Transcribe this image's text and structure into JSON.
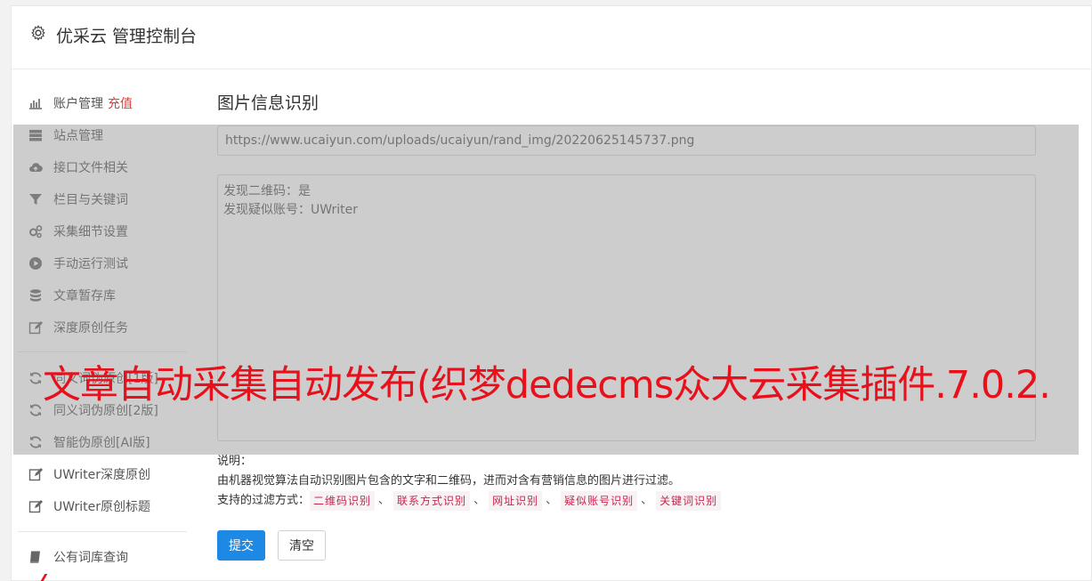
{
  "header": {
    "title": "优采云 管理控制台",
    "icon": "gear-icon"
  },
  "sidebar": {
    "items": [
      {
        "label": "账户管理",
        "extra": "充值",
        "icon": "bar-chart-icon"
      },
      {
        "label": "站点管理",
        "icon": "server-icon"
      },
      {
        "label": "接口文件相关",
        "icon": "cloud-upload-icon"
      },
      {
        "label": "栏目与关键词",
        "icon": "filter-icon"
      },
      {
        "label": "采集细节设置",
        "icon": "gears-icon"
      },
      {
        "label": "手动运行测试",
        "icon": "play-circle-icon"
      },
      {
        "label": "文章暂存库",
        "icon": "database-icon"
      },
      {
        "label": "深度原创任务",
        "icon": "edit-icon"
      },
      {
        "label": "同义词伪原创[1版]",
        "icon": "refresh-icon"
      },
      {
        "label": "同义词伪原创[2版]",
        "icon": "refresh-icon"
      },
      {
        "label": "智能伪原创[AI版]",
        "icon": "refresh-icon"
      },
      {
        "label": "UWriter深度原创",
        "icon": "edit-icon"
      },
      {
        "label": "UWriter原创标题",
        "icon": "edit-icon"
      },
      {
        "label": "公有词库查询",
        "icon": "book-icon"
      }
    ]
  },
  "main": {
    "title": "图片信息识别",
    "url_value": "https://www.ucaiyun.com/uploads/ucaiyun/rand_img/20220625145737.png",
    "result_lines": [
      "发现二维码：是",
      "发现疑似账号：UWriter"
    ],
    "notes": {
      "heading": "说明：",
      "description": "由机器视觉算法自动识别图片包含的文字和二维码，进而对含有营销信息的图片进行过滤。",
      "filter_label": "支持的过滤方式：",
      "filters": [
        "二维码识别",
        "联系方式识别",
        "网址识别",
        "疑似账号识别",
        "关键词识别"
      ],
      "separator": "、"
    },
    "submit_label": "提交",
    "clear_label": "清空"
  },
  "watermark": "文章自动采集自动发布(织梦dedecms众大云采集插件.7.0.2.",
  "colors": {
    "primary": "#1e88e5",
    "recharge": "#e53935",
    "watermark": "#e8101a",
    "tag": "#c7254e"
  }
}
